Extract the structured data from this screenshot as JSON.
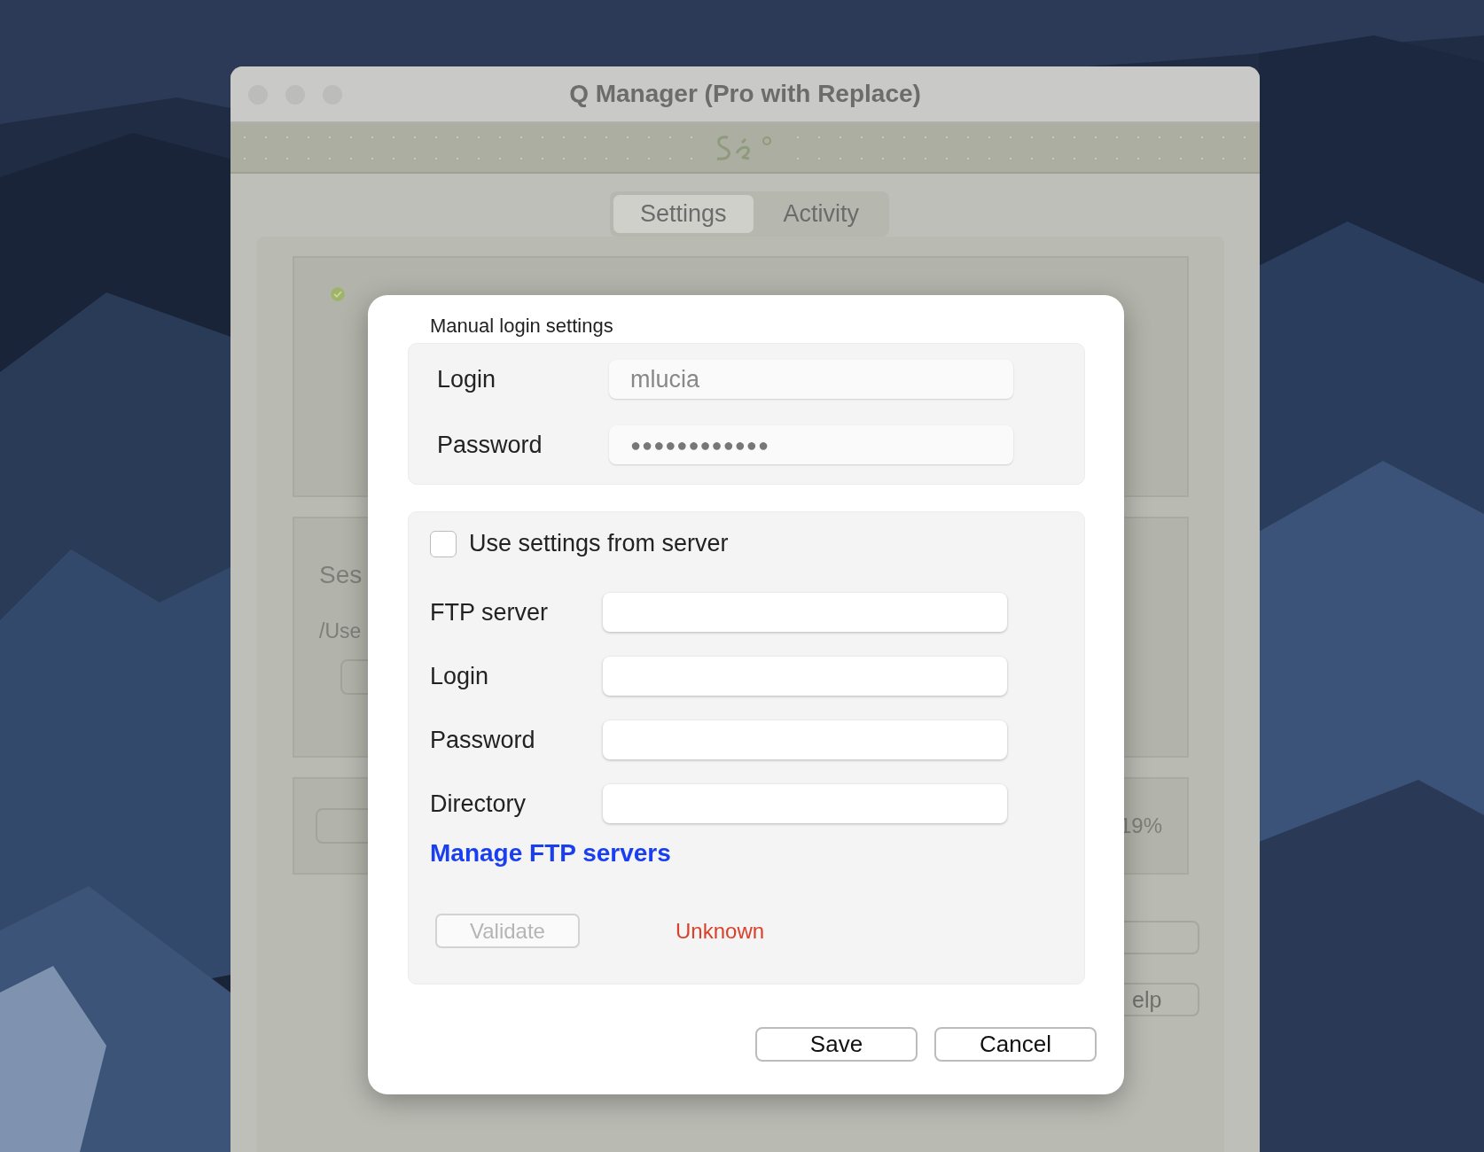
{
  "window": {
    "title": "Q Manager (Pro with Replace)"
  },
  "tabs": [
    {
      "label": "Settings",
      "selected": true
    },
    {
      "label": "Activity",
      "selected": false
    }
  ],
  "background": {
    "session_label": "Ses",
    "path_text": "/Use",
    "progress_text": "19%",
    "help_button": "elp"
  },
  "dialog": {
    "heading": "Manual login settings",
    "account_fields": [
      {
        "label": "Login",
        "value": "mlucia",
        "kind": "text"
      },
      {
        "label": "Password",
        "value": "●●●●●●●●●●●●",
        "kind": "password"
      }
    ],
    "use_server_settings": {
      "label": "Use settings from server",
      "checked": false
    },
    "ftp_fields": [
      {
        "label": "FTP server"
      },
      {
        "label": "Login"
      },
      {
        "label": "Password"
      },
      {
        "label": "Directory"
      }
    ],
    "manage_link": "Manage FTP servers",
    "validate_button": {
      "label": "Validate",
      "disabled": true
    },
    "status": "Unknown",
    "buttons": [
      "Save",
      "Cancel"
    ]
  }
}
